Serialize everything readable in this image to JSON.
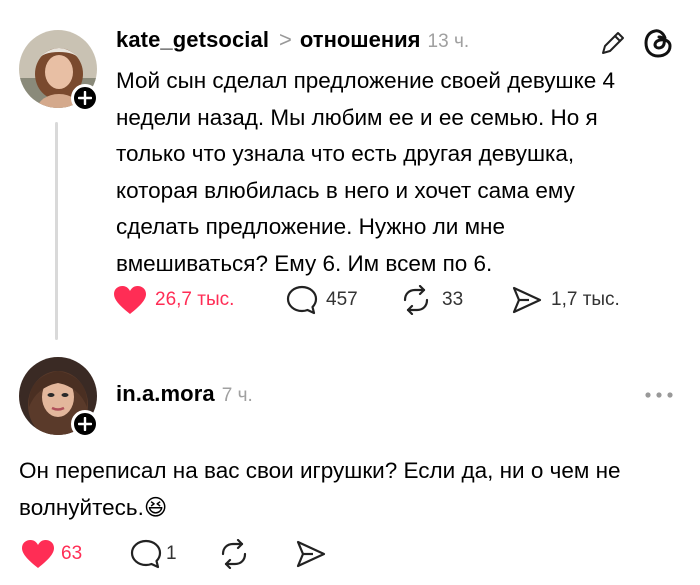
{
  "post": {
    "username": "kate_getsocial",
    "topic_separator": ">",
    "topic": "отношения",
    "time": "13 ч.",
    "text": "Мой сын сделал предложение своей девушке 4 недели назад. Мы любим ее и ее семью. Но я только что узнала что есть другая девушка, которая влюбилась в него и хочет сама ему сделать предложение. Нужно ли мне вмешиваться? Ему 6. Им всем по 6.",
    "likes": "26,7 тыс.",
    "comments": "457",
    "reposts": "33",
    "shares": "1,7 тыс."
  },
  "reply": {
    "username": "in.a.mora",
    "time": "7 ч.",
    "text": "Он переписал на вас свои игрушки? Если да, ни о чем не волнуйтесь.",
    "emoji": "😆",
    "likes": "63",
    "comments": "1"
  },
  "colors": {
    "like_red": "#ff2d55",
    "muted": "#a0a0a0",
    "icon": "#222222"
  }
}
